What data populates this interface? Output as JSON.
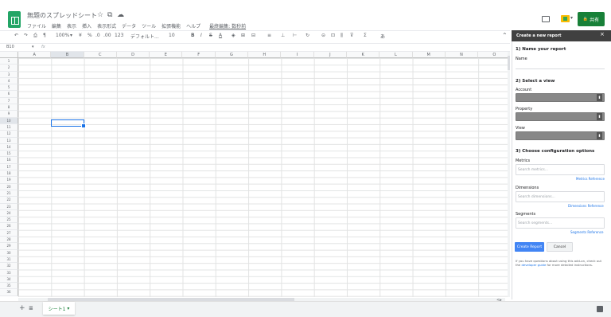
{
  "doc": {
    "title": "無題のスプレッドシート",
    "star_icon": "☆",
    "folder_icon": "⧉",
    "cloud_icon": "☁"
  },
  "menu": [
    "ファイル",
    "編集",
    "表示",
    "挿入",
    "表示形式",
    "データ",
    "ツール",
    "拡張機能",
    "ヘルプ"
  ],
  "menu_last_edit": "最終編集: 数秒前",
  "share_label": "共有",
  "share_icon": "🔒",
  "toolbar": {
    "undo": "↶",
    "redo": "↷",
    "print": "⎙",
    "paint_format": "¶",
    "zoom": "100%",
    "zoom_caret": "▾",
    "currency": "¥",
    "percent": "%",
    "decrease_decimal": ".0",
    "increase_decimal": ".00",
    "more_formats": "123",
    "font": "デフォルト...",
    "font_size": "10",
    "bold": "B",
    "italic": "I",
    "strike": "S",
    "text_color": "A",
    "fill": "◈",
    "borders": "⊞",
    "merge": "⊟",
    "halign": "≡",
    "valign": "⊥",
    "wrap": "⊢",
    "rotate": "↻",
    "link": "⊝",
    "comment": "⊡",
    "chart": "⫼",
    "filter": "⊽",
    "functions": "Σ",
    "input_tools": "あ",
    "collapse": "⌃"
  },
  "formula_bar": {
    "cell_ref": "B10",
    "caret": "▾",
    "fx": "fx"
  },
  "columns": [
    "A",
    "B",
    "C",
    "D",
    "E",
    "F",
    "G",
    "H",
    "I",
    "J",
    "K",
    "L",
    "M",
    "N",
    "O"
  ],
  "selected_column": "B",
  "rows": [
    "1",
    "2",
    "3",
    "4",
    "5",
    "6",
    "7",
    "8",
    "9",
    "10",
    "11",
    "12",
    "13",
    "14",
    "15",
    "16",
    "17",
    "18",
    "19",
    "20",
    "21",
    "22",
    "23",
    "24",
    "25",
    "26",
    "27",
    "28",
    "29",
    "30",
    "31",
    "32",
    "33",
    "34",
    "35",
    "36"
  ],
  "selected_row": "10",
  "bottom": {
    "add_sheet": "+",
    "sheets_menu": "≣",
    "sheet_tab": "シート1",
    "sheet_caret": "▾",
    "explore": "<",
    "explore_caret": "▸"
  },
  "panel": {
    "header": "Create a new report",
    "close": "×",
    "step1": "1) Name your report",
    "name_label": "Name",
    "step2": "2) Select a view",
    "account_label": "Account",
    "property_label": "Property",
    "view_label": "View",
    "select_arrow": "⬍",
    "step3": "3) Choose configuration options",
    "metrics_label": "Metrics",
    "metrics_placeholder": "Search metrics...",
    "metrics_ref": "Metrics Reference",
    "dimensions_label": "Dimensions",
    "dimensions_placeholder": "Search dimensions...",
    "dimensions_ref": "Dimensions Reference",
    "segments_label": "Segments",
    "segments_placeholder": "Search segments...",
    "segments_ref": "Segments Reference",
    "create_button": "Create Report",
    "cancel_button": "Cancel",
    "help_prefix": "If you have questions about using this add-on, check out the ",
    "help_link": "developer guide",
    "help_suffix": " for more detailed instructions."
  },
  "colors": {
    "sheets_green": "#23a566",
    "share_green": "#188038",
    "selection_blue": "#1a73e8",
    "panel_header": "#404040",
    "create_blue": "#4285f4"
  }
}
